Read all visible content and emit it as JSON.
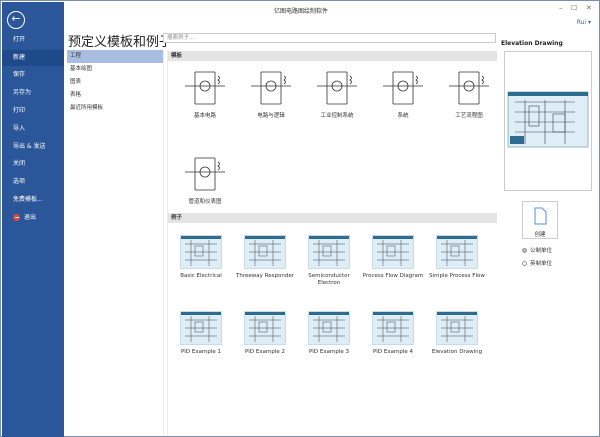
{
  "window": {
    "title": "亿图电路图绘制软件",
    "user": "Rui ▾",
    "minimize": "–",
    "maximize": "☐",
    "close": "✕"
  },
  "sidebar": {
    "items": [
      {
        "label": "打开"
      },
      {
        "label": "新建",
        "selected": true
      },
      {
        "label": "保存"
      },
      {
        "label": "另存为"
      },
      {
        "label": "打印"
      },
      {
        "label": "导入"
      },
      {
        "label": "导出 & 发送"
      },
      {
        "label": "关闭"
      },
      {
        "label": "选项"
      },
      {
        "label": "免费模板..."
      },
      {
        "label": "退出",
        "icon": "exit-icon"
      }
    ]
  },
  "header": {
    "title": "预定义模板和例子",
    "search_placeholder": "搜索例子..."
  },
  "categories": [
    {
      "label": "工程",
      "selected": true
    },
    {
      "label": "基本绘图"
    },
    {
      "label": "图表"
    },
    {
      "label": "表格"
    },
    {
      "label": "最近所用模板"
    }
  ],
  "templates": {
    "header": "模板",
    "items": [
      {
        "label": "基本电路"
      },
      {
        "label": "电路与逻辑"
      },
      {
        "label": "工业控制系统"
      },
      {
        "label": "系统"
      },
      {
        "label": "工艺流程图"
      },
      {
        "label": "管道和仪表图"
      }
    ]
  },
  "examples": {
    "header": "例子",
    "items": [
      {
        "label": "Basic Electrical"
      },
      {
        "label": "Threeway Responder"
      },
      {
        "label": "Semiconductor Electron"
      },
      {
        "label": "Process Flow Diagram"
      },
      {
        "label": "Simple Process Flow"
      },
      {
        "label": "PID Example 1"
      },
      {
        "label": "PID Example 2"
      },
      {
        "label": "PID Example 3"
      },
      {
        "label": "PID Example 4"
      },
      {
        "label": "Elevation Drawing"
      }
    ]
  },
  "preview": {
    "title": "Elevation Drawing",
    "create_label": "创建",
    "units": [
      {
        "label": "公制单位",
        "selected": true
      },
      {
        "label": "英制单位",
        "selected": false
      }
    ]
  },
  "colors": {
    "sidebar": "#2b579a",
    "selected_category": "#a9bde0"
  }
}
